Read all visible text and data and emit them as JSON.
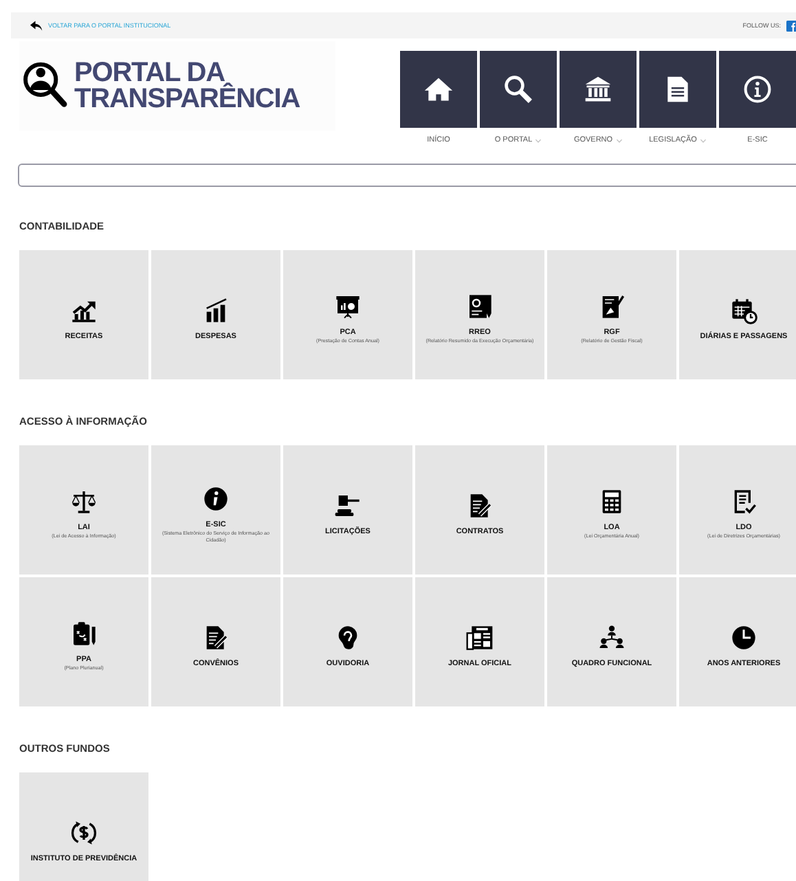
{
  "top_bar": {
    "back_link": "VOLTAR PARA O PORTAL INSTITUCIONAL",
    "follow_label": "FOLLOW US:"
  },
  "logo": {
    "line_1": "PORTAL DA",
    "line_2": "TRANSPARÊNCIA"
  },
  "nav": [
    {
      "label": "INÍCIO",
      "dropdown": false
    },
    {
      "label": "O PORTAL",
      "dropdown": true
    },
    {
      "label": "GOVERNO",
      "dropdown": true
    },
    {
      "label": "LEGISLAÇÃO",
      "dropdown": true
    },
    {
      "label": "E-SIC",
      "dropdown": false
    }
  ],
  "sections": [
    {
      "title": "CONTABILIDADE",
      "tiles": [
        {
          "title": "RECEITAS"
        },
        {
          "title": "DESPESAS"
        },
        {
          "title": "PCA",
          "subtitle": "(Prestação de Contas Anual)"
        },
        {
          "title": "RREO",
          "subtitle": "(Relatório Resumido da Execução Orçamentária)"
        },
        {
          "title": "RGF",
          "subtitle": "(Relatório de Gestão Fiscal)"
        },
        {
          "title": "DIÁRIAS E PASSAGENS"
        }
      ]
    },
    {
      "title": "ACESSO À INFORMAÇÃO",
      "tiles": [
        {
          "title": "LAI",
          "subtitle": "(Lei de Acesso à Informação)"
        },
        {
          "title": "E-SIC",
          "subtitle": "(Sistema Eletrônico do Serviço de Informação ao Cidadão)"
        },
        {
          "title": "LICITAÇÕES"
        },
        {
          "title": "CONTRATOS"
        },
        {
          "title": "LOA",
          "subtitle": "(Lei Orçamentária Anual)"
        },
        {
          "title": "LDO",
          "subtitle": "(Lei de Diretrizes Orçamentárias)"
        },
        {
          "title": "PPA",
          "subtitle": "(Plano Plurianual)"
        },
        {
          "title": "CONVÊNIOS"
        },
        {
          "title": "OUVIDORIA"
        },
        {
          "title": "JORNAL OFICIAL"
        },
        {
          "title": "QUADRO FUNCIONAL"
        },
        {
          "title": "ANOS ANTERIORES"
        }
      ]
    },
    {
      "title": "OUTROS FUNDOS",
      "tiles": [
        {
          "title": "INSTITUTO DE PREVIDÊNCIA"
        }
      ]
    }
  ]
}
